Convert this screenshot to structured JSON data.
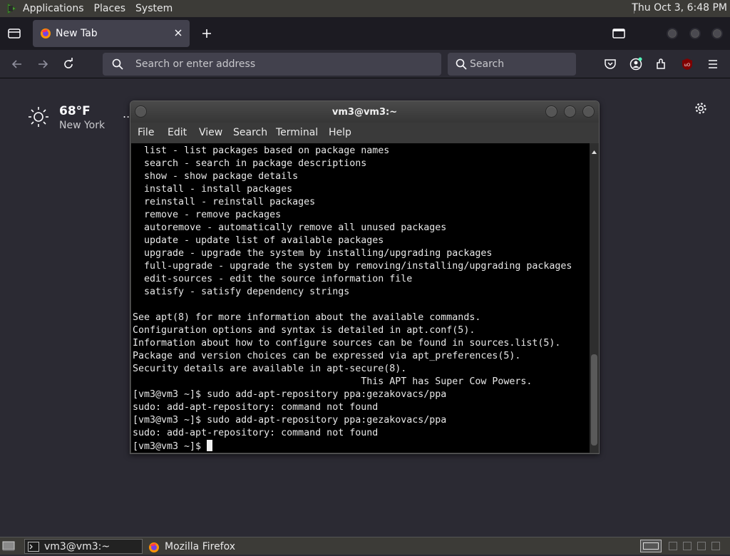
{
  "top_panel": {
    "menus": [
      "Applications",
      "Places",
      "System"
    ],
    "clock": "Thu Oct  3,  6:48 PM"
  },
  "browser": {
    "tab_title": "New Tab",
    "url_placeholder": "Search or enter address",
    "search_placeholder": "Search"
  },
  "newtab": {
    "weather_temp": "68°F",
    "weather_location": "New York",
    "weather_more": ".."
  },
  "terminal": {
    "title": "vm3@vm3:~",
    "menu": [
      "File",
      "Edit",
      "View",
      "Search",
      "Terminal",
      "Help"
    ],
    "lines": [
      "  list - list packages based on package names",
      "  search - search in package descriptions",
      "  show - show package details",
      "  install - install packages",
      "  reinstall - reinstall packages",
      "  remove - remove packages",
      "  autoremove - automatically remove all unused packages",
      "  update - update list of available packages",
      "  upgrade - upgrade the system by installing/upgrading packages",
      "  full-upgrade - upgrade the system by removing/installing/upgrading packages",
      "  edit-sources - edit the source information file",
      "  satisfy - satisfy dependency strings",
      "",
      "See apt(8) for more information about the available commands.",
      "Configuration options and syntax is detailed in apt.conf(5).",
      "Information about how to configure sources can be found in sources.list(5).",
      "Package and version choices can be expressed via apt_preferences(5).",
      "Security details are available in apt-secure(8).",
      "                                        This APT has Super Cow Powers.",
      "[vm3@vm3 ~]$ sudo add-apt-repository ppa:gezakovacs/ppa",
      "sudo: add-apt-repository: command not found",
      "[vm3@vm3 ~]$ sudo add-apt-repository ppa:gezakovacs/ppa",
      "sudo: add-apt-repository: command not found"
    ],
    "prompt": "[vm3@vm3 ~]$ ",
    "scroll_position": 0.94
  },
  "taskbar": {
    "tasks": [
      "vm3@vm3:~",
      "Mozilla Firefox"
    ]
  },
  "colors": {
    "browser_bg": "#2b2a33",
    "panel_bg": "#3c3b37",
    "terminal_bg": "#000000"
  }
}
